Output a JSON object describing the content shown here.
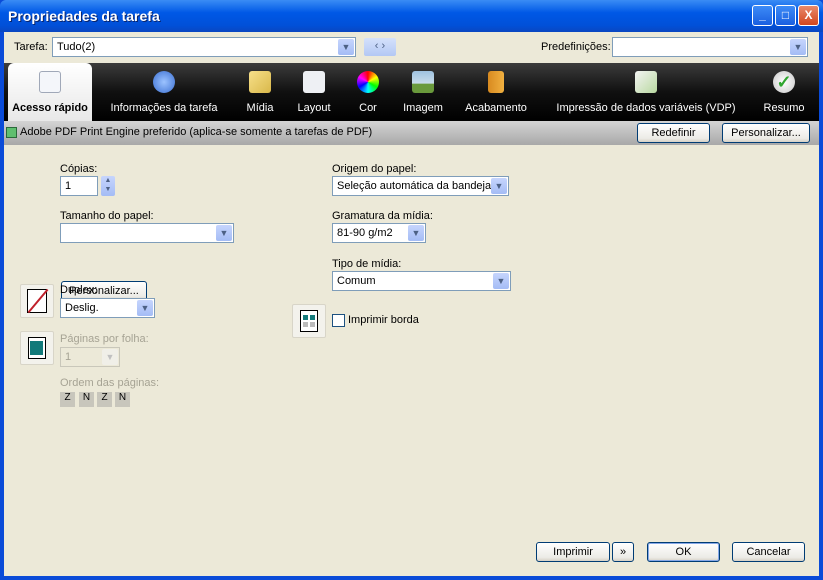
{
  "window": {
    "title": "Propriedades da tarefa",
    "minimize": "_",
    "maximize": "□",
    "close": "X"
  },
  "toolbar": {
    "task_label": "Tarefa:",
    "task_value": "Tudo(2)",
    "nav": "‹ ›",
    "presets_label": "Predefinições:",
    "presets_value": ""
  },
  "tabs": [
    {
      "label": "Acesso rápido",
      "icon": "document-icon"
    },
    {
      "label": "Informações da tarefa",
      "icon": "info-icon"
    },
    {
      "label": "Mídia",
      "icon": "media-icon"
    },
    {
      "label": "Layout",
      "icon": "layout-icon"
    },
    {
      "label": "Cor",
      "icon": "color-wheel-icon"
    },
    {
      "label": "Imagem",
      "icon": "image-icon"
    },
    {
      "label": "Acabamento",
      "icon": "finishing-icon"
    },
    {
      "label": "Impressão de dados variáveis (VDP)",
      "icon": "vdp-icon"
    },
    {
      "label": "Resumo",
      "icon": "checkmark-icon"
    }
  ],
  "infobar": {
    "text": "Adobe PDF Print Engine preferido (aplica-se somente a tarefas de PDF)",
    "reset": "Redefinir",
    "customize": "Personalizar..."
  },
  "form": {
    "copies_label": "Cópias:",
    "copies_value": "1",
    "paper_size_label": "Tamanho do papel:",
    "paper_size_value": "",
    "customize": "Personalizar...",
    "duplex_label": "Duplex:",
    "duplex_value": "Deslig.",
    "pages_per_sheet_label": "Páginas por folha:",
    "pages_per_sheet_value": "1",
    "page_order_label": "Ordem das páginas:",
    "paper_source_label": "Origem do papel:",
    "paper_source_value": "Seleção automática da bandeja",
    "weight_label": "Gramatura da mídia:",
    "weight_value": "81-90 g/m2",
    "media_type_label": "Tipo de mídia:",
    "media_type_value": "Comum",
    "print_border_label": "Imprimir borda",
    "print_border_checked": false
  },
  "footer": {
    "print": "Imprimir",
    "more": "»",
    "ok": "OK",
    "cancel": "Cancelar"
  },
  "colors": {
    "titlebar": "#0058e6",
    "dialog_bg": "#ece9d8",
    "tab_band": "#000000"
  }
}
